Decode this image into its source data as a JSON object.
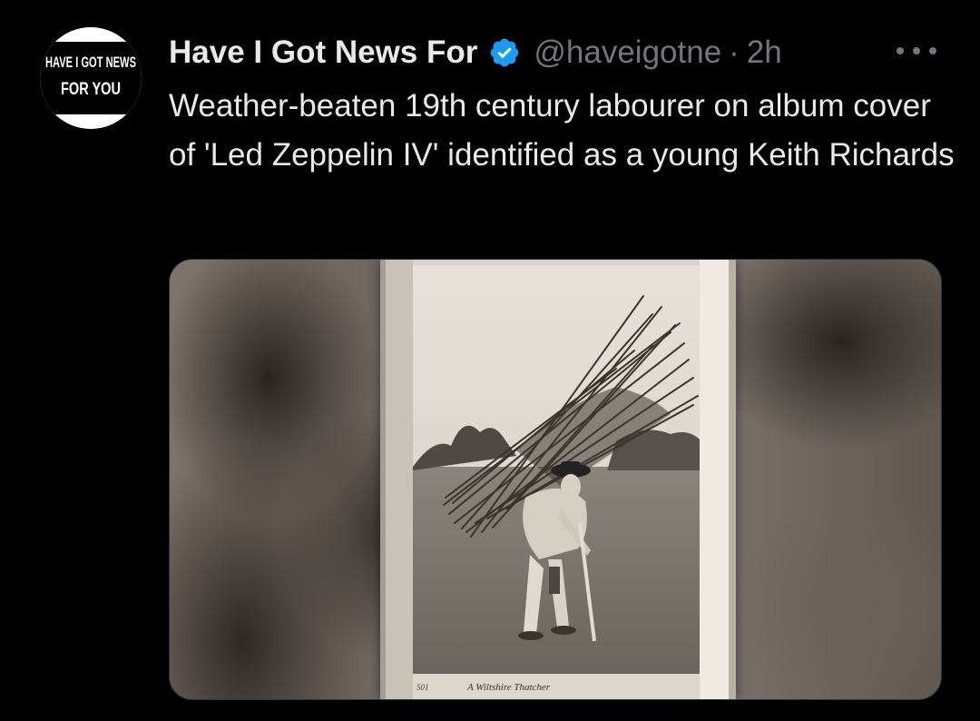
{
  "tweet": {
    "author_name": "Have I Got News For",
    "handle": "@haveigotne",
    "separator": "·",
    "time": "2h",
    "text": "Weather-beaten 19th century labourer on album cover of 'Led Zeppelin IV' identified as a young Keith Richards",
    "avatar_text_line1": "HAVE I GOT NEWS",
    "avatar_text_line2": "FOR YOU",
    "verified_color": "#1d9bf0"
  },
  "media": {
    "photo_number": "501",
    "photo_caption": "A Wiltshire Thatcher"
  },
  "icons": {
    "verified": "verified-badge-icon",
    "more": "more-options-icon"
  }
}
